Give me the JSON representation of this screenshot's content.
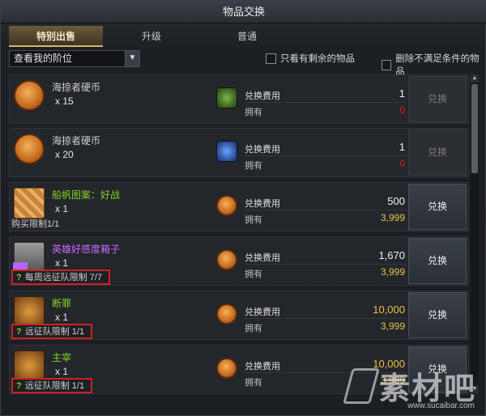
{
  "window": {
    "title": "物品交换"
  },
  "tabs": [
    {
      "label": "特别出售",
      "active": true
    },
    {
      "label": "升级",
      "active": false
    },
    {
      "label": "普通",
      "active": false
    }
  ],
  "filter": {
    "dropdown_value": "查看我的阶位",
    "checkbox_remaining": "只看有剩余的物品",
    "checkbox_hide_unmet": "删除不满足条件的物品"
  },
  "labels": {
    "cost": "兑换费用",
    "own": "拥有",
    "exchange": "兑换"
  },
  "items": [
    {
      "name": "海掠者硬币",
      "name_color": "#d0d0d0",
      "qty": "x 15",
      "icon": "coin-icon",
      "cost_icon": "green-token-icon",
      "cost": "1",
      "own": "0",
      "own_color": "#e02020",
      "limit": "",
      "limit_highlight": false,
      "button_enabled": false
    },
    {
      "name": "海掠者硬币",
      "name_color": "#d0d0d0",
      "qty": "x 20",
      "icon": "coin-icon",
      "cost_icon": "blue-token-icon",
      "cost": "1",
      "own": "0",
      "own_color": "#e02020",
      "limit": "",
      "limit_highlight": false,
      "button_enabled": false
    },
    {
      "name": "船帆图案：好战",
      "name_color": "#7ed321",
      "qty": "x 1",
      "icon": "sail-pattern-icon",
      "cost_icon": "coin-icon",
      "cost": "500",
      "own": "3,999",
      "own_color": "#e8c24a",
      "limit": "购买限制1/1",
      "limit_highlight": false,
      "button_enabled": true
    },
    {
      "name": "英雄好感度箱子",
      "name_color": "#c869ff",
      "qty": "x 1",
      "icon": "chest-icon",
      "cost_icon": "coin-icon",
      "cost": "1,670",
      "own": "3,999",
      "own_color": "#e8c24a",
      "limit": "每周远征队限制 7/7",
      "limit_highlight": true,
      "button_enabled": true
    },
    {
      "name": "断罪",
      "name_color": "#7ed321",
      "qty": "x 1",
      "icon": "rune-icon",
      "cost_icon": "coin-icon",
      "cost": "10,000",
      "own": "3,999",
      "own_color": "#e8c24a",
      "limit": "远征队限制 1/1",
      "limit_highlight": true,
      "button_enabled": true
    },
    {
      "name": "主宰",
      "name_color": "#7ed321",
      "qty": "x 1",
      "icon": "rune-icon",
      "cost_icon": "coin-icon",
      "cost": "10,000",
      "own": "3,999",
      "own_color": "#e8c24a",
      "limit": "远征队限制 1/1",
      "limit_highlight": true,
      "button_enabled": true
    }
  ],
  "watermark": {
    "main": "素材吧",
    "url": "www.sucaibar.com"
  }
}
